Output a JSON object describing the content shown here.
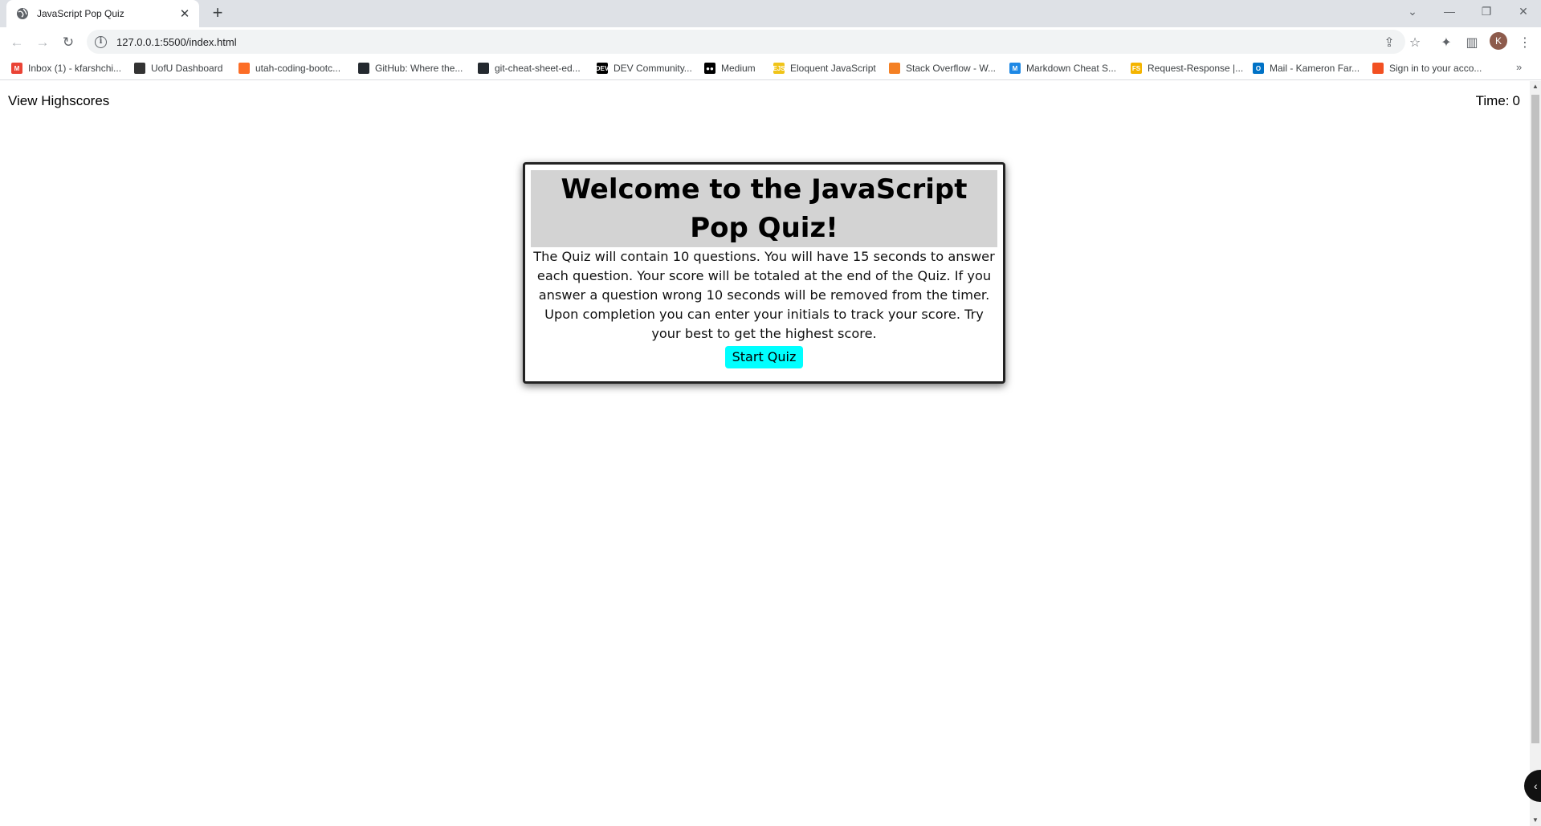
{
  "browser": {
    "tab_title": "JavaScript Pop Quiz",
    "tab_close": "✕",
    "new_tab": "+",
    "url": "127.0.0.1:5500/index.html",
    "avatar_letter": "K",
    "bookmarks": [
      {
        "label": "Inbox (1) - kfarshchi...",
        "icon": "gmail-icon",
        "color": "#ea4335",
        "glyph": "M"
      },
      {
        "label": "UofU Dashboard",
        "icon": "canvas-icon",
        "color": "#333333",
        "glyph": ""
      },
      {
        "label": "utah-coding-bootc...",
        "icon": "gitlab-icon",
        "color": "#fc6d26",
        "glyph": ""
      },
      {
        "label": "GitHub: Where the...",
        "icon": "github-icon",
        "color": "#24292f",
        "glyph": ""
      },
      {
        "label": "git-cheat-sheet-ed...",
        "icon": "github-icon",
        "color": "#24292f",
        "glyph": ""
      },
      {
        "label": "DEV Community...",
        "icon": "dev-icon",
        "color": "#000000",
        "glyph": "DEV"
      },
      {
        "label": "Medium",
        "icon": "medium-icon",
        "color": "#000000",
        "glyph": "●●"
      },
      {
        "label": "Eloquent JavaScript",
        "icon": "ejs-icon",
        "color": "#f0c419",
        "glyph": "EJS"
      },
      {
        "label": "Stack Overflow - W...",
        "icon": "stackoverflow-icon",
        "color": "#f48024",
        "glyph": ""
      },
      {
        "label": "Markdown Cheat S...",
        "icon": "markdown-icon",
        "color": "#1e88e5",
        "glyph": "M"
      },
      {
        "label": "Request-Response |...",
        "icon": "request-response-icon",
        "color": "#f4b400",
        "glyph": "FS"
      },
      {
        "label": "Mail - Kameron Far...",
        "icon": "outlook-icon",
        "color": "#0072c6",
        "glyph": "O"
      },
      {
        "label": "Sign in to your acco...",
        "icon": "microsoft-icon",
        "color": "#f25022",
        "glyph": ""
      }
    ],
    "bookmarks_more": "»"
  },
  "page": {
    "highscores_label": "View Highscores",
    "timer_label": "Time:",
    "timer_value": "0",
    "quiz_title": "Welcome to the JavaScript Pop Quiz!",
    "quiz_description": "The Quiz will contain 10 questions. You will have 15 seconds to answer each question. Your score will be totaled at the end of the Quiz. If you answer a question wrong 10 seconds will be removed from the timer. Upon completion you can enter your initials to track your score. Try your best to get the highest score.",
    "start_button": "Start Quiz"
  },
  "colors": {
    "start_button_bg": "#00ffff",
    "title_bg": "#d3d3d3",
    "tabstrip_bg": "#dee1e6"
  }
}
